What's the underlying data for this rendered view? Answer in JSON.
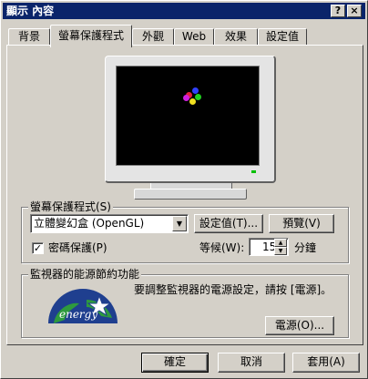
{
  "window": {
    "title": "顯示 內容",
    "help_button": "?",
    "close_button": "×"
  },
  "tabs": [
    {
      "label": "背景",
      "active": false
    },
    {
      "label": "螢幕保護程式",
      "active": true
    },
    {
      "label": "外觀",
      "active": false
    },
    {
      "label": "Web",
      "active": false
    },
    {
      "label": "效果",
      "active": false
    },
    {
      "label": "設定值",
      "active": false
    }
  ],
  "screensaver_group": {
    "title": "螢幕保護程式(S)",
    "selected": "立體變幻盒 (OpenGL)",
    "settings_button": "設定值(T)...",
    "preview_button": "預覽(V)",
    "password_label": "密碼保護(P)",
    "password_checked": true,
    "wait_label": "等候(W):",
    "wait_value": "15",
    "wait_unit": "分鐘"
  },
  "energy_group": {
    "title": "監視器的能源節約功能",
    "description": "要調整監視器的電源設定，請按 [電源]。",
    "power_button": "電源(O)...",
    "logo_text": "energy"
  },
  "footer": {
    "ok": "確定",
    "cancel": "取消",
    "apply": "套用(A)"
  },
  "colors": {
    "title_bar": "#0a246a",
    "face": "#d4d0c8",
    "energy_star_blue": "#1f3f8f",
    "energy_star_green": "#2e9a3e"
  }
}
